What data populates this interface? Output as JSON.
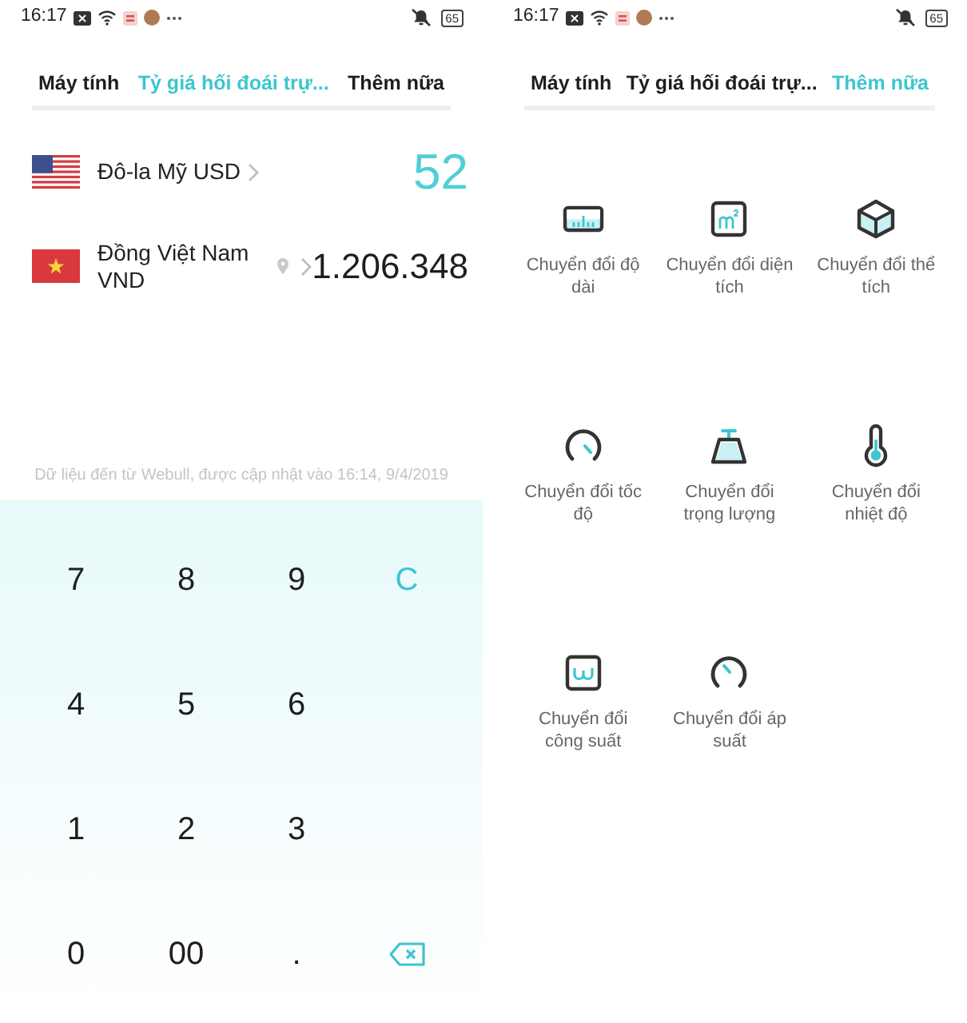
{
  "screens": [
    {
      "status_bar": {
        "time": "16:17",
        "battery": "65"
      },
      "tabs": [
        {
          "label": "Máy tính",
          "selected": false
        },
        {
          "label": "Tỷ giá hối đoái trự...",
          "selected": true
        },
        {
          "label": "Thêm nữa",
          "selected": false
        }
      ],
      "kind": "exchange",
      "currencies": [
        {
          "kind": "us",
          "name": "Đô-la Mỹ USD",
          "amount": "52",
          "selected": true,
          "located": false
        },
        {
          "kind": "vn",
          "name": "Đồng Việt Nam VND",
          "amount": "1.206.348",
          "selected": false,
          "located": true
        }
      ],
      "source_note": "Dữ liệu đến từ Webull, được cập nhật vào 16:14, 9/4/2019",
      "keypad": {
        "rows": [
          {
            "keys": [
              {
                "kind": "digit",
                "label": "7"
              },
              {
                "kind": "digit",
                "label": "8"
              },
              {
                "kind": "digit",
                "label": "9"
              },
              {
                "kind": "clear",
                "label": "C"
              }
            ]
          },
          {
            "keys": [
              {
                "kind": "digit",
                "label": "4"
              },
              {
                "kind": "digit",
                "label": "5"
              },
              {
                "kind": "digit",
                "label": "6"
              }
            ]
          },
          {
            "keys": [
              {
                "kind": "digit",
                "label": "1"
              },
              {
                "kind": "digit",
                "label": "2"
              },
              {
                "kind": "digit",
                "label": "3"
              }
            ]
          },
          {
            "keys": [
              {
                "kind": "digit",
                "label": "0"
              },
              {
                "kind": "digit",
                "label": "00"
              },
              {
                "kind": "digit",
                "label": "."
              },
              {
                "kind": "backspace"
              }
            ]
          }
        ]
      }
    },
    {
      "status_bar": {
        "time": "16:17",
        "battery": "65"
      },
      "tabs": [
        {
          "label": "Máy tính",
          "selected": false
        },
        {
          "label": "Tỷ giá hối đoái trự...",
          "selected": false
        },
        {
          "label": "Thêm nữa",
          "selected": true
        }
      ],
      "kind": "tools",
      "tools": [
        {
          "kind": "length",
          "label": "Chuyển đổi độ dài"
        },
        {
          "kind": "area",
          "label": "Chuyển đổi diện tích"
        },
        {
          "kind": "volume",
          "label": "Chuyển đổi thể tích"
        },
        {
          "kind": "speed",
          "label": "Chuyển đổi tốc độ"
        },
        {
          "kind": "weight",
          "label": "Chuyển đổi trọng lượng"
        },
        {
          "kind": "temperature",
          "label": "Chuyển đổi nhiệt độ"
        },
        {
          "kind": "power",
          "label": "Chuyển đổi công suất"
        },
        {
          "kind": "pressure",
          "label": "Chuyển đổi áp suất"
        }
      ]
    }
  ]
}
